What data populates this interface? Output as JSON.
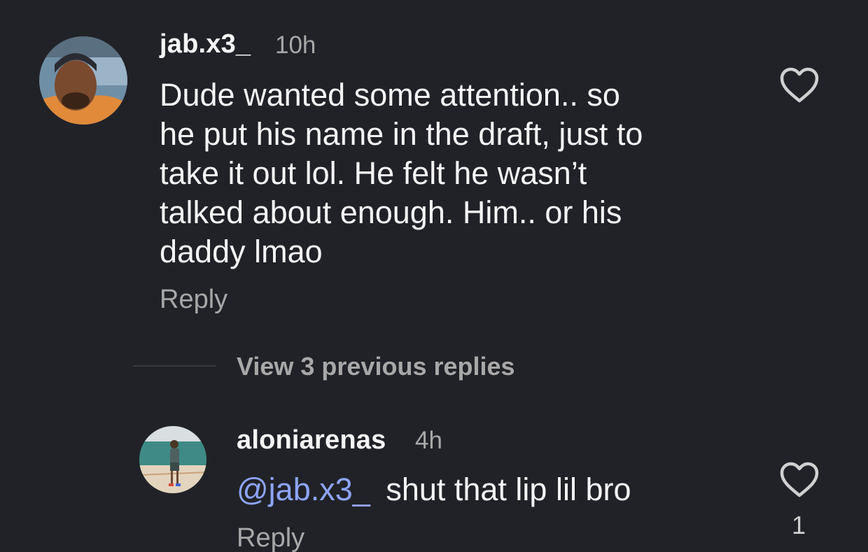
{
  "comments": [
    {
      "username": "jab.x3_",
      "time": "10h",
      "text": "Dude wanted some attention.. so he put his name in the draft, just to take it out lol. He felt he wasn’t talked about enough. Him.. or his daddy lmao",
      "lines": [
        "Dude wanted some attention.. so",
        "he put his name in the draft, just to",
        "take it out lol. He felt he wasn’t",
        "talked about enough. Him.. or his",
        "daddy lmao"
      ],
      "reply_label": "Reply",
      "like_icon": "heart-outline-icon",
      "like_count": ""
    }
  ],
  "thread": {
    "view_replies_label": "View 3 previous replies"
  },
  "reply": {
    "username": "aloniarenas",
    "time": "4h",
    "mention": "@jab.x3_",
    "text": "shut that lip lil bro",
    "reply_label": "Reply",
    "like_icon": "heart-outline-icon",
    "like_count": "1"
  },
  "colors": {
    "background": "#212227",
    "text": "#f5f5f5",
    "secondary": "#a8a8a8",
    "mention": "#8ea5ff"
  }
}
